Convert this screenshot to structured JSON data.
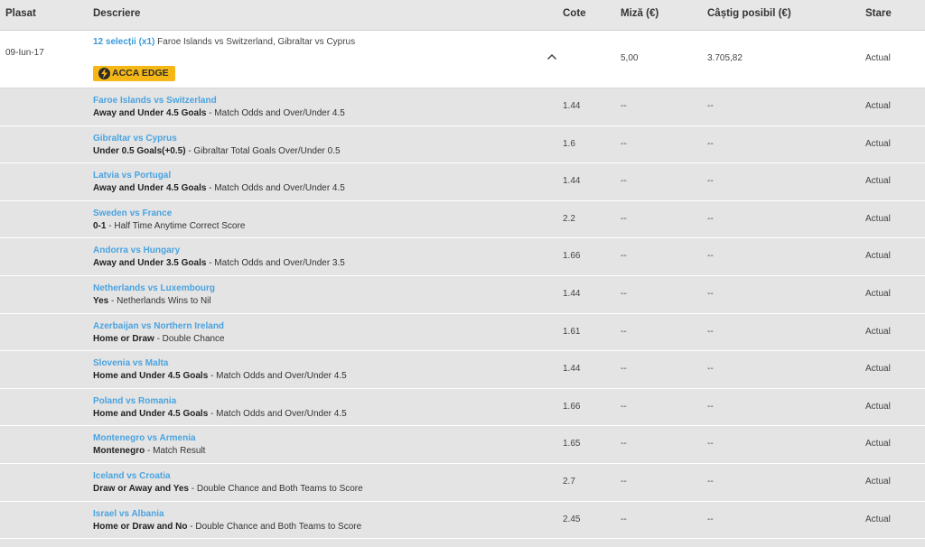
{
  "header": {
    "placed": "Plasat",
    "description": "Descriere",
    "odds": "Cote",
    "stake": "Miză (€)",
    "possible_win": "Câștig posibil (€)",
    "status": "Stare"
  },
  "summary": {
    "date": "09-Iun-17",
    "selection_count": "12 selecții (x1)",
    "matches_text": "Faroe Islands vs Switzerland, Gibraltar vs Cyprus",
    "badge": "ACCA EDGE",
    "stake": "5,00",
    "possible_win": "3.705,82",
    "status": "Actual"
  },
  "selections": [
    {
      "match": "Faroe Islands vs Switzerland",
      "pick": "Away and Under 4.5 Goals",
      "market": "- Match Odds and Over/Under 4.5",
      "odds": "1.44",
      "stake": "--",
      "win": "--",
      "status": "Actual"
    },
    {
      "match": "Gibraltar vs Cyprus",
      "pick": "Under 0.5 Goals(+0.5)",
      "market": "- Gibraltar Total Goals Over/Under 0.5",
      "odds": "1.6",
      "stake": "--",
      "win": "--",
      "status": "Actual"
    },
    {
      "match": "Latvia vs Portugal",
      "pick": "Away and Under 4.5 Goals",
      "market": "- Match Odds and Over/Under 4.5",
      "odds": "1.44",
      "stake": "--",
      "win": "--",
      "status": "Actual"
    },
    {
      "match": "Sweden vs France",
      "pick": "0-1",
      "market": "- Half Time Anytime Correct Score",
      "odds": "2.2",
      "stake": "--",
      "win": "--",
      "status": "Actual"
    },
    {
      "match": "Andorra vs Hungary",
      "pick": "Away and Under 3.5 Goals",
      "market": "- Match Odds and Over/Under 3.5",
      "odds": "1.66",
      "stake": "--",
      "win": "--",
      "status": "Actual"
    },
    {
      "match": "Netherlands vs Luxembourg",
      "pick": "Yes",
      "market": "- Netherlands Wins to Nil",
      "odds": "1.44",
      "stake": "--",
      "win": "--",
      "status": "Actual"
    },
    {
      "match": "Azerbaijan vs Northern Ireland",
      "pick": "Home or Draw",
      "market": "- Double Chance",
      "odds": "1.61",
      "stake": "--",
      "win": "--",
      "status": "Actual"
    },
    {
      "match": "Slovenia vs Malta",
      "pick": "Home and Under 4.5 Goals",
      "market": "- Match Odds and Over/Under 4.5",
      "odds": "1.44",
      "stake": "--",
      "win": "--",
      "status": "Actual"
    },
    {
      "match": "Poland vs Romania",
      "pick": "Home and Under 4.5 Goals",
      "market": "- Match Odds and Over/Under 4.5",
      "odds": "1.66",
      "stake": "--",
      "win": "--",
      "status": "Actual"
    },
    {
      "match": "Montenegro vs Armenia",
      "pick": "Montenegro",
      "market": "- Match Result",
      "odds": "1.65",
      "stake": "--",
      "win": "--",
      "status": "Actual"
    },
    {
      "match": "Iceland vs Croatia",
      "pick": "Draw or Away and Yes",
      "market": "- Double Chance and Both Teams to Score",
      "odds": "2.7",
      "stake": "--",
      "win": "--",
      "status": "Actual"
    },
    {
      "match": "Israel vs Albania",
      "pick": "Home or Draw and No",
      "market": "- Double Chance and Both Teams to Score",
      "odds": "2.45",
      "stake": "--",
      "win": "--",
      "status": "Actual"
    }
  ],
  "colors": {
    "link": "#4aa3e0",
    "badge": "#f5b715",
    "row_bg": "#e4e4e4",
    "summary_bg": "#ffffff"
  },
  "icons": {
    "badge_icon": "lightning-bolt-icon",
    "toggle_icon": "chevron-up-icon"
  }
}
